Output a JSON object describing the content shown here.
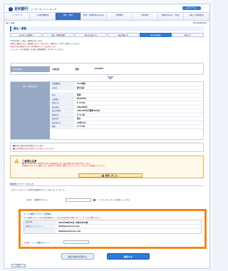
{
  "header": {
    "bank_name": "足利銀行",
    "service_name": "インターネットバンキング",
    "logout_label": "ログアウト"
  },
  "gnav": [
    {
      "label": "トップページ"
    },
    {
      "label": "入出金明細照会"
    },
    {
      "label": "振込・振替"
    },
    {
      "label": "税金・各種料金の払込み"
    },
    {
      "label": "定期預金"
    },
    {
      "label": "外貨預金"
    },
    {
      "label": "各種お申込み・手続き"
    },
    {
      "label": "お客さま情報変更"
    }
  ],
  "subbar": {
    "breadcrumb": "振込・振替",
    "date": "2012年08月08日"
  },
  "page_title": "振込・振替",
  "tabs": [
    {
      "label": "お引出し口座選択"
    },
    {
      "label": "振込・振替先選択"
    },
    {
      "label": "振込先口座入力"
    },
    {
      "label": "振込金額入力"
    },
    {
      "label": "振込内容確認"
    },
    {
      "label": "振込完了"
    }
  ],
  "intro": {
    "line1": "下記の内容で、振込・振替を実行します。",
    "line2": "内容をご確認のうえ、確認用パスワードを入力し「確定する」ボタンを押してください。",
    "line3_red": "※振込内容の確認のため、受付確認のメールを送信します。",
    "line4": "メールアドレスの変更は「お客さま情報変更」から行ってください。"
  },
  "account": {
    "header": "お引出口座",
    "branch": "大塚支店",
    "type": "普通",
    "number": "1234567"
  },
  "detail": {
    "side_label": "振込・振替先口座",
    "bank_label": "金融機関名",
    "bank": "1111銀行",
    "branch_label": "支店名",
    "branch": "春日支店",
    "type_label": "科目",
    "type": "普通",
    "number_label": "口座番号",
    "number": "8123456",
    "name_label": "受取人名",
    "name": "ﾀﾞｲｲﾁ ﾀﾛｳ",
    "amount_label": "振込金額",
    "amount": "100,000円",
    "fee_label": "振込手数料",
    "fee": "100,105円(手数料105円)",
    "requester_label": "依頼人名",
    "requester": "ﾀﾞｲｲﾁ ﾀﾛｳ",
    "kind_label": "振込指定",
    "kind": "振込",
    "date_label": "振込指定日",
    "date": "10月01日",
    "memo_label": "摘要",
    "memo": "ﾀﾞｲｲﾁ ﾀﾛｳ"
  },
  "notes": {
    "line1": "■振込先口座の内容が確認されています。",
    "line2_red": "■振込手数料はお引出口座より引き落としいたします。"
  },
  "warning": {
    "title": "二重振込注意",
    "text1": "●2012年08月08日 16時05分に同一内容(振込先口座・振込金額)の振込を受け付けています。",
    "text2": "お間違いのないようご確認のうえ、振込を行う場合は「確認しました。」のチェックボックスを選択してください。",
    "confirm_label": "確認しました。"
  },
  "password_section": {
    "title": "確認用パスワードの入力",
    "desc": "ログインパスワードとは異なる確認用パスワードを入力してください。",
    "required": "【必須】",
    "label": "確認用パスワード",
    "keyboard_label": "ソフトウェアキーボードを使用して入力する"
  },
  "mail_section": {
    "title": "メール通知パスワード送信先",
    "desc": "メール通知パスワードを含む受付確認のメールを下記の送信先へ送信しました。メールをご確認ください。",
    "sent_label": "送信日時",
    "sent_value": "2012年08月08日 16時26分10秒",
    "addr_label": "送信先メールアドレス",
    "addr1": "datatano@xxxx.com",
    "addr2": "datatano2@xxxx.com",
    "required": "【必須】",
    "pwd_label": "メール通知パスワード"
  },
  "buttons": {
    "back": "振込内容を変更する",
    "confirm": "確定する",
    "footer_back": "戻る"
  }
}
